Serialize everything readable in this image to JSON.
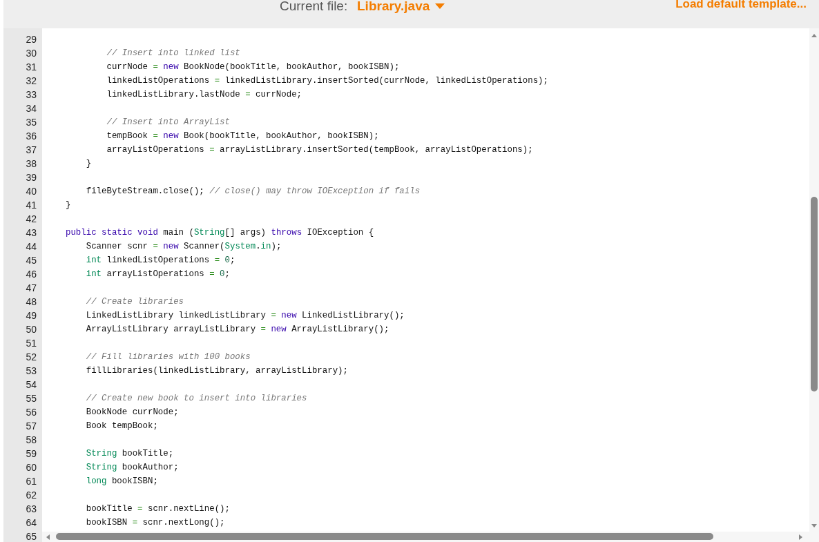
{
  "header": {
    "current_file_label": "Current file:",
    "file_name": "Library.java",
    "load_template": "Load default template..."
  },
  "editor": {
    "lines": [
      {
        "number": "29"
      },
      {
        "number": "30",
        "code": [
          {
            "kind": "comment",
            "text": "        // Insert into linked list"
          }
        ]
      },
      {
        "number": "31",
        "code": [
          {
            "kind": "plain",
            "text": "        currNode "
          },
          {
            "kind": "op",
            "text": "= "
          },
          {
            "kind": "keyword",
            "text": "new"
          },
          {
            "kind": "plain",
            "text": " BookNode(bookTitle, bookAuthor, bookISBN);"
          }
        ]
      },
      {
        "number": "32",
        "code": [
          {
            "kind": "plain",
            "text": "        linkedListOperations "
          },
          {
            "kind": "op",
            "text": "="
          },
          {
            "kind": "plain",
            "text": " linkedListLibrary.insertSorted(currNode, linkedListOperations);"
          }
        ]
      },
      {
        "number": "33",
        "code": [
          {
            "kind": "plain",
            "text": "        linkedListLibrary.lastNode "
          },
          {
            "kind": "op",
            "text": "="
          },
          {
            "kind": "plain",
            "text": " currNode;"
          }
        ]
      },
      {
        "number": "34"
      },
      {
        "number": "35",
        "code": [
          {
            "kind": "comment",
            "text": "        // Insert into ArrayList"
          }
        ]
      },
      {
        "number": "36",
        "code": [
          {
            "kind": "plain",
            "text": "        tempBook "
          },
          {
            "kind": "op",
            "text": "= "
          },
          {
            "kind": "keyword",
            "text": "new"
          },
          {
            "kind": "plain",
            "text": " Book(bookTitle, bookAuthor, bookISBN);"
          }
        ]
      },
      {
        "number": "37",
        "code": [
          {
            "kind": "plain",
            "text": "        arrayListOperations "
          },
          {
            "kind": "op",
            "text": "="
          },
          {
            "kind": "plain",
            "text": " arrayListLibrary.insertSorted(tempBook, arrayListOperations);"
          }
        ]
      },
      {
        "number": "38",
        "code": [
          {
            "kind": "plain",
            "text": "    }"
          }
        ]
      },
      {
        "number": "39"
      },
      {
        "number": "40",
        "code": [
          {
            "kind": "plain",
            "text": "    fileByteStream.close(); "
          },
          {
            "kind": "comment",
            "text": "// close() may throw IOException if fails"
          }
        ]
      },
      {
        "number": "41",
        "code": [
          {
            "kind": "plain",
            "text": "}"
          }
        ]
      },
      {
        "number": "42"
      },
      {
        "number": "43",
        "code": [
          {
            "kind": "keyword",
            "text": "public static void"
          },
          {
            "kind": "plain",
            "text": " main ("
          },
          {
            "kind": "type",
            "text": "String"
          },
          {
            "kind": "plain",
            "text": "[] args) "
          },
          {
            "kind": "keyword",
            "text": "throws"
          },
          {
            "kind": "plain",
            "text": " IOException {"
          }
        ]
      },
      {
        "number": "44",
        "code": [
          {
            "kind": "plain",
            "text": "    Scanner scnr "
          },
          {
            "kind": "op",
            "text": "= "
          },
          {
            "kind": "keyword",
            "text": "new"
          },
          {
            "kind": "plain",
            "text": " Scanner("
          },
          {
            "kind": "type",
            "text": "System"
          },
          {
            "kind": "plain",
            "text": "."
          },
          {
            "kind": "type",
            "text": "in"
          },
          {
            "kind": "plain",
            "text": ");"
          }
        ]
      },
      {
        "number": "45",
        "code": [
          {
            "kind": "type",
            "text": "    int"
          },
          {
            "kind": "plain",
            "text": " linkedListOperations "
          },
          {
            "kind": "op",
            "text": "= "
          },
          {
            "kind": "number",
            "text": "0"
          },
          {
            "kind": "plain",
            "text": ";"
          }
        ]
      },
      {
        "number": "46",
        "code": [
          {
            "kind": "type",
            "text": "    int"
          },
          {
            "kind": "plain",
            "text": " arrayListOperations "
          },
          {
            "kind": "op",
            "text": "= "
          },
          {
            "kind": "number",
            "text": "0"
          },
          {
            "kind": "plain",
            "text": ";"
          }
        ]
      },
      {
        "number": "47"
      },
      {
        "number": "48",
        "code": [
          {
            "kind": "comment",
            "text": "    // Create libraries"
          }
        ]
      },
      {
        "number": "49",
        "code": [
          {
            "kind": "plain",
            "text": "    LinkedListLibrary linkedListLibrary "
          },
          {
            "kind": "op",
            "text": "= "
          },
          {
            "kind": "keyword",
            "text": "new"
          },
          {
            "kind": "plain",
            "text": " LinkedListLibrary();"
          }
        ]
      },
      {
        "number": "50",
        "code": [
          {
            "kind": "plain",
            "text": "    ArrayListLibrary arrayListLibrary "
          },
          {
            "kind": "op",
            "text": "= "
          },
          {
            "kind": "keyword",
            "text": "new"
          },
          {
            "kind": "plain",
            "text": " ArrayListLibrary();"
          }
        ]
      },
      {
        "number": "51"
      },
      {
        "number": "52",
        "code": [
          {
            "kind": "comment",
            "text": "    // Fill libraries with 100 books"
          }
        ]
      },
      {
        "number": "53",
        "code": [
          {
            "kind": "plain",
            "text": "    fillLibraries(linkedListLibrary, arrayListLibrary);"
          }
        ]
      },
      {
        "number": "54"
      },
      {
        "number": "55",
        "code": [
          {
            "kind": "comment",
            "text": "    // Create new book to insert into libraries"
          }
        ]
      },
      {
        "number": "56",
        "code": [
          {
            "kind": "plain",
            "text": "    BookNode currNode;"
          }
        ]
      },
      {
        "number": "57",
        "code": [
          {
            "kind": "plain",
            "text": "    Book tempBook;"
          }
        ]
      },
      {
        "number": "58"
      },
      {
        "number": "59",
        "code": [
          {
            "kind": "type",
            "text": "    String"
          },
          {
            "kind": "plain",
            "text": " bookTitle;"
          }
        ]
      },
      {
        "number": "60",
        "code": [
          {
            "kind": "type",
            "text": "    String"
          },
          {
            "kind": "plain",
            "text": " bookAuthor;"
          }
        ]
      },
      {
        "number": "61",
        "code": [
          {
            "kind": "type",
            "text": "    long"
          },
          {
            "kind": "plain",
            "text": " bookISBN;"
          }
        ]
      },
      {
        "number": "62"
      },
      {
        "number": "63",
        "code": [
          {
            "kind": "plain",
            "text": "    bookTitle "
          },
          {
            "kind": "op",
            "text": "="
          },
          {
            "kind": "plain",
            "text": " scnr.nextLine();"
          }
        ]
      },
      {
        "number": "64",
        "code": [
          {
            "kind": "plain",
            "text": "    bookISBN "
          },
          {
            "kind": "op",
            "text": "="
          },
          {
            "kind": "plain",
            "text": " scnr.nextLong();"
          }
        ]
      },
      {
        "number": "65"
      }
    ]
  }
}
